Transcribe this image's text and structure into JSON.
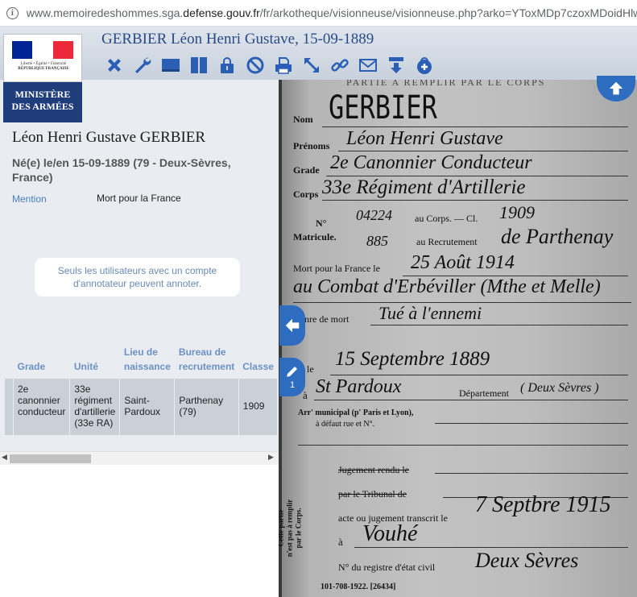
{
  "browser": {
    "url_host_prefix": "www.memoiredeshommes.sga.",
    "url_host_domain": "defense.gouv.fr",
    "url_path": "/fr/arkotheque/visionneuse/visionneuse.php?arko=YToxMDp7czoxMDoidHlwZ"
  },
  "logo": {
    "motto": "Liberté • Égalité • Fraternité",
    "republic": "RÉPUBLIQUE FRANÇAISE",
    "ministry_line1": "MINISTÈRE",
    "ministry_line2": "DES ARMÉES",
    "flag_colors": [
      "#002395",
      "#ffffff",
      "#ed2939"
    ]
  },
  "header": {
    "title": "GERBIER Léon Henri Gustave, 15-09-1889",
    "toolbar_icons": [
      "close-icon",
      "wrench-icon",
      "single-page-icon",
      "double-page-icon",
      "lock-icon",
      "forbidden-icon",
      "print-icon",
      "fullscreen-icon",
      "link-icon",
      "mail-icon",
      "download-icon",
      "lock-add-icon"
    ],
    "accent": "#2a5fb5"
  },
  "person": {
    "name": "Léon Henri Gustave GERBIER",
    "birth_line1": "Né(e) le/en 15-09-1889 (79 - Deux-Sèvres,",
    "birth_line2": "France)",
    "mention_label": "Mention",
    "mention_value": "Mort pour la France"
  },
  "notice": {
    "line1": "Seuls les utilisateurs avec un compte",
    "line2": "d'annotateur peuvent annoter."
  },
  "table": {
    "headers": {
      "grade": "Grade",
      "unite": "Unité",
      "lieu_1": "Lieu de",
      "lieu_2": "naissance",
      "bureau_1": "Bureau de",
      "bureau_2": "recrutement",
      "classe": "Classe"
    },
    "row": {
      "grade_1": "2e",
      "grade_2": "canonnier",
      "grade_3": "conducteur",
      "unite_1": "33e",
      "unite_2": "régiment",
      "unite_3": "d'artillerie",
      "unite_4": "(33e RA)",
      "lieu_1": "Saint-",
      "lieu_2": "Pardoux",
      "bureau_1": "Parthenay",
      "bureau_2": "(79)",
      "classe": "1909"
    }
  },
  "viewer": {
    "annotation_count": "1",
    "form": {
      "top_banner": "PARTIE A REMPLIR PAR LE CORPS",
      "nom_label": "Nom",
      "nom_value": "GERBIER",
      "prenoms_label": "Prénoms",
      "prenoms_value": "Léon  Henri  Gustave",
      "grade_label": "Grade",
      "grade_value": "2e Canonnier Conducteur",
      "corps_label": "Corps",
      "corps_value": "33e Régiment d'Artillerie",
      "no_label": "N°",
      "matricule_label": "Matricule.",
      "corps_no_value": "04224",
      "au_corps_label": "au Corps. — Cl.",
      "classe_value": "1909",
      "recrut_no_value": "885",
      "recrut_label": "au Recrutement",
      "recrut_value": "de Parthenay",
      "mort_label": "Mort pour la France le",
      "mort_value": "25 Août 1914",
      "lieu_value": "au Combat d'Erbéviller (Mthe et Melle)",
      "genre_label": "Genre de mort",
      "genre_value": "Tué à l'ennemi",
      "ne_label": "Né le",
      "ne_value": "15 Septembre 1889",
      "a_label": "à",
      "a_value": "St Pardoux",
      "dept_label": "Département",
      "dept_value": "( Deux Sèvres )",
      "arr_label_1": "Arr' municipal (p' Paris et Lyon),",
      "arr_label_2": "à défaut rue et N°.",
      "jugement_1": "Jugement rendu le",
      "jugement_2": "par le Tribunal de",
      "acte_label": "acte ou jugement transcrit le",
      "acte_value": "7 Septbre 1915",
      "a2_label": "à",
      "a2_value": "Vouhé",
      "registre_label": "N° du registre d'état civil",
      "registre_value": "Deux Sèvres",
      "side_1": "Cette partie",
      "side_2": "n'est pas à remplir",
      "side_3": "par le Corps.",
      "footer": "101-708-1922.   [26434]"
    }
  }
}
